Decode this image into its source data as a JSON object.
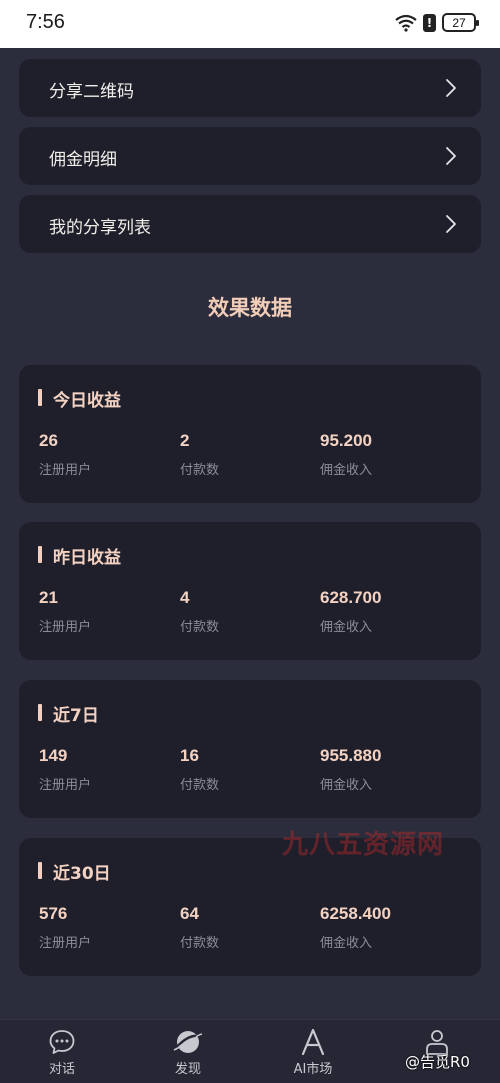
{
  "status_bar": {
    "time": "7:56",
    "battery": "27"
  },
  "menu": [
    {
      "label": "分享二维码"
    },
    {
      "label": "佣金明细"
    },
    {
      "label": "我的分享列表"
    }
  ],
  "section_title": "效果数据",
  "stats": [
    {
      "title": "今日收益",
      "registered": "26",
      "registered_label": "注册用户",
      "payments": "2",
      "payments_label": "付款数",
      "commission": "95.200",
      "commission_label": "佣金收入"
    },
    {
      "title": "昨日收益",
      "registered": "21",
      "registered_label": "注册用户",
      "payments": "4",
      "payments_label": "付款数",
      "commission": "628.700",
      "commission_label": "佣金收入"
    },
    {
      "title": "近7日",
      "registered": "149",
      "registered_label": "注册用户",
      "payments": "16",
      "payments_label": "付款数",
      "commission": "955.880",
      "commission_label": "佣金收入"
    },
    {
      "title": "近30日",
      "registered": "576",
      "registered_label": "注册用户",
      "payments": "64",
      "payments_label": "付款数",
      "commission": "6258.400",
      "commission_label": "佣金收入"
    }
  ],
  "watermark": "九八五资源网",
  "tabs": [
    {
      "label": "对话",
      "icon": "chat-icon"
    },
    {
      "label": "发现",
      "icon": "planet-icon"
    },
    {
      "label": "AI市场",
      "icon": "ai-letter-icon"
    },
    {
      "label": "",
      "icon": "user-icon"
    }
  ],
  "credit": "@告觅R0",
  "colors": {
    "background": "#2c2d3c",
    "card": "#1f1f2b",
    "accent": "#f4d2c2",
    "muted": "#8c8c99"
  }
}
